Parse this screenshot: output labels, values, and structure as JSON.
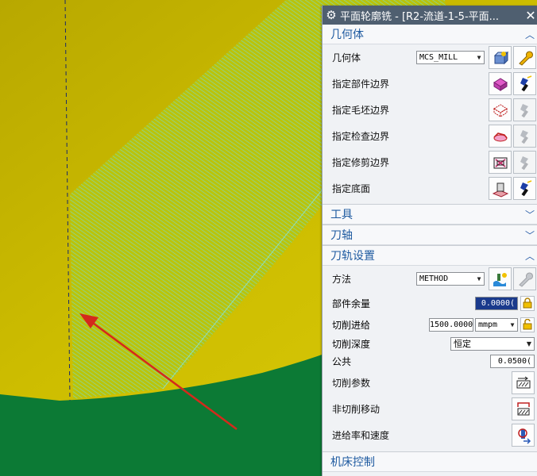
{
  "viewport": {
    "green": "#0c7a35",
    "yellow": "#c7b600",
    "hatch": "#7fd8b5",
    "arrow": "#d42a1c"
  },
  "panel": {
    "title": "平面轮廓铣 - [R2-流道-1-5-平面...",
    "sections": {
      "geometry": {
        "header": "几何体",
        "geometry_label": "几何体",
        "geometry_value": "MCS_MILL",
        "part_boundary": "指定部件边界",
        "blank_boundary": "指定毛坯边界",
        "check_boundary": "指定检查边界",
        "trim_boundary": "指定修剪边界",
        "floor": "指定底面"
      },
      "tool": {
        "header": "工具"
      },
      "axis": {
        "header": "刀轴"
      },
      "path": {
        "header": "刀轨设置",
        "method_label": "方法",
        "method_value": "METHOD",
        "stock_label": "部件余量",
        "stock_value": "0.0000(",
        "feed_label": "切削进给",
        "feed_value": "1500.0000",
        "feed_unit": "mmpm",
        "depth_label": "切削深度",
        "depth_value": "恒定",
        "common_label": "公共",
        "common_value": "0.0500(",
        "cut_params": "切削参数",
        "non_cut": "非切削移动",
        "feeds_speeds": "进给率和速度"
      },
      "next": {
        "header": "机床控制"
      }
    }
  }
}
